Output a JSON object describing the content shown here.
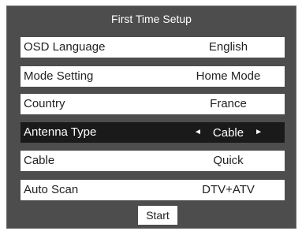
{
  "title": "First Time Setup",
  "settings": [
    {
      "label": "OSD Language",
      "value": "English"
    },
    {
      "label": "Mode Setting",
      "value": "Home Mode"
    },
    {
      "label": "Country",
      "value": "France"
    },
    {
      "label": "Antenna Type",
      "value": "Cable",
      "selected": true
    },
    {
      "label": "Cable",
      "value": "Quick"
    },
    {
      "label": "Auto Scan",
      "value": "DTV+ATV"
    }
  ],
  "start_label": "Start",
  "icons": {
    "left_arrow": "◄",
    "right_arrow": "►"
  },
  "colors": {
    "panel_bg": "#4d4d4d",
    "row_bg": "#ffffff",
    "selected_bg": "#1a1a1a"
  }
}
